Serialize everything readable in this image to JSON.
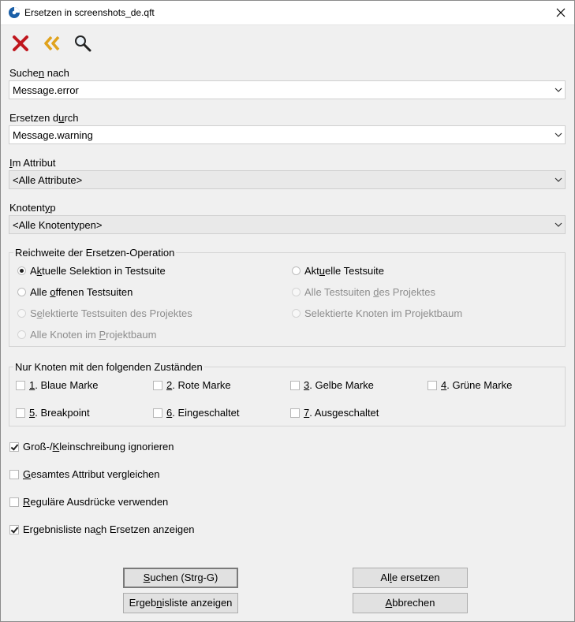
{
  "window": {
    "title": "Ersetzen in screenshots_de.qft"
  },
  "toolbar": {
    "items": [
      "delete-icon",
      "back-double-chevron-icon",
      "search-icon"
    ]
  },
  "search": {
    "label_pre": "Suche",
    "label_u": "n",
    "label_post": " nach",
    "value": "Message.error"
  },
  "replace": {
    "label_pre": "Ersetzen d",
    "label_u": "u",
    "label_post": "rch",
    "value": "Message.warning"
  },
  "attribute": {
    "label_u": "I",
    "label_post": "m Attribut",
    "value": "<Alle Attribute>"
  },
  "nodetype": {
    "label_pre": "Knotent",
    "label_u": "y",
    "label_post": "p",
    "value": "<Alle Knotentypen>"
  },
  "scope": {
    "title": "Reichweite der Ersetzen-Operation",
    "options": [
      {
        "pre": "A",
        "u": "k",
        "post": "tuelle Selektion in Testsuite",
        "checked": true,
        "enabled": true
      },
      {
        "pre": "Akt",
        "u": "u",
        "post": "elle Testsuite",
        "checked": false,
        "enabled": true
      },
      {
        "pre": "Alle ",
        "u": "o",
        "post": "ffenen Testsuiten",
        "checked": false,
        "enabled": true
      },
      {
        "pre": "Alle Testsuiten ",
        "u": "d",
        "post": "es Projektes",
        "checked": false,
        "enabled": false
      },
      {
        "pre": "S",
        "u": "e",
        "post": "lektierte Testsuiten des Projektes",
        "checked": false,
        "enabled": false
      },
      {
        "pre": "Selektierte Knoten im Projektbaum",
        "u": "",
        "post": "",
        "checked": false,
        "enabled": false
      },
      {
        "pre": "Alle Knoten im ",
        "u": "P",
        "post": "rojektbaum",
        "checked": false,
        "enabled": false
      }
    ]
  },
  "states": {
    "title": "Nur Knoten mit den folgenden Zuständen",
    "items": [
      {
        "u": "1",
        "post": ". Blaue Marke",
        "checked": false
      },
      {
        "u": "2",
        "post": ". Rote Marke",
        "checked": false
      },
      {
        "u": "3",
        "post": ". Gelbe Marke",
        "checked": false
      },
      {
        "u": "4",
        "post": ". Grüne Marke",
        "checked": false
      },
      {
        "u": "5",
        "post": ". Breakpoint",
        "checked": false
      },
      {
        "u": "6",
        "post": ". Eingeschaltet",
        "checked": false
      },
      {
        "u": "7",
        "post": ". Ausgeschaltet",
        "checked": false
      }
    ]
  },
  "options": [
    {
      "pre": "Groß-/",
      "u": "K",
      "post": "leinschreibung ignorieren",
      "checked": true
    },
    {
      "pre": "",
      "u": "G",
      "post": "esamtes Attribut vergleichen",
      "checked": false
    },
    {
      "pre": "",
      "u": "R",
      "post": "eguläre Ausdrücke verwenden",
      "checked": false
    },
    {
      "pre": "Ergebnisliste na",
      "u": "c",
      "post": "h Ersetzen anzeigen",
      "checked": true
    }
  ],
  "buttons": {
    "search": {
      "pre": "",
      "u": "S",
      "post": "uchen (Strg-G)"
    },
    "replace_all": {
      "pre": "Al",
      "u": "l",
      "post": "e ersetzen"
    },
    "result_list": {
      "pre": "Ergeb",
      "u": "n",
      "post": "isliste anzeigen"
    },
    "cancel": {
      "pre": "",
      "u": "A",
      "post": "bbrechen"
    }
  },
  "colors": {
    "delete": "#c0171e",
    "back": "#e0a21c",
    "accent": "#1a5fa8"
  }
}
